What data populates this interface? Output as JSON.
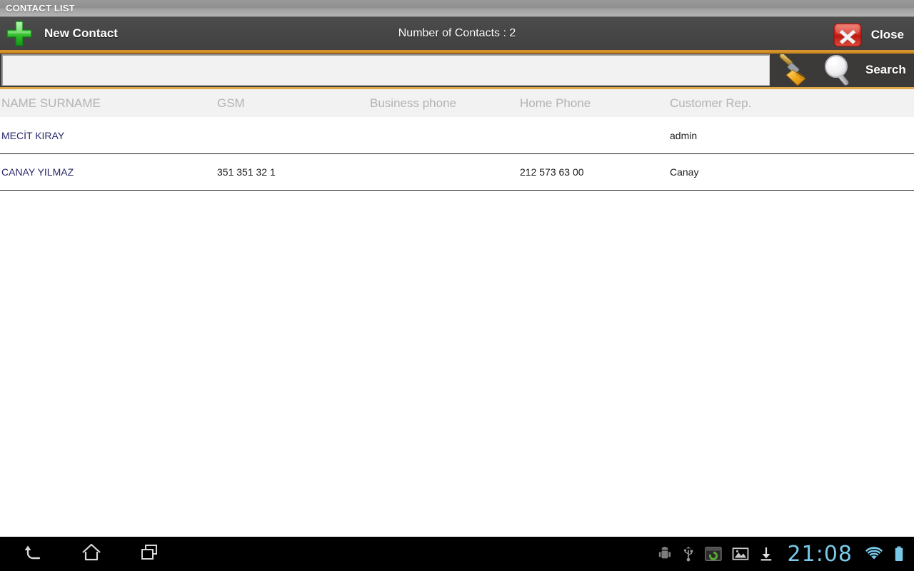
{
  "window": {
    "title": "CONTACT LIST"
  },
  "actionbar": {
    "new_contact_label": "New Contact",
    "contacts_count_label": "Number of Contacts : 2",
    "close_label": "Close",
    "plus_icon": "plus-icon",
    "close_icon": "close-x-icon"
  },
  "search": {
    "value": "",
    "placeholder": "",
    "clear_icon": "broom-icon",
    "search_icon": "magnifier-icon",
    "search_label": "Search"
  },
  "table": {
    "columns": [
      "NAME SURNAME",
      "GSM",
      "Business phone",
      "Home Phone",
      "Customer Rep."
    ],
    "rows": [
      {
        "name": "MECİT KIRAY",
        "gsm": "",
        "business_phone": "",
        "home_phone": "",
        "customer_rep": "admin"
      },
      {
        "name": "CANAY YILMAZ",
        "gsm": "351 351 32 1",
        "business_phone": "",
        "home_phone": "212 573 63 00",
        "customer_rep": "Canay"
      }
    ]
  },
  "systembar": {
    "back_icon": "back-arrow-icon",
    "home_icon": "home-icon",
    "recents_icon": "recent-apps-icon",
    "status_icons": [
      "android-debug-icon",
      "usb-icon",
      "app-sync-icon",
      "image-icon",
      "download-icon"
    ],
    "clock": "21:08",
    "wifi_icon": "wifi-icon",
    "battery_icon": "battery-icon"
  },
  "colors": {
    "accent_orange": "#e0a84a",
    "accent_orange_dark": "#c98a22",
    "actionbar_bg": "#464646",
    "searchbar_bg": "#3c3a38",
    "name_link": "#27276b",
    "header_text": "#b3b3b3",
    "clock_cyan": "#79c8e8"
  }
}
